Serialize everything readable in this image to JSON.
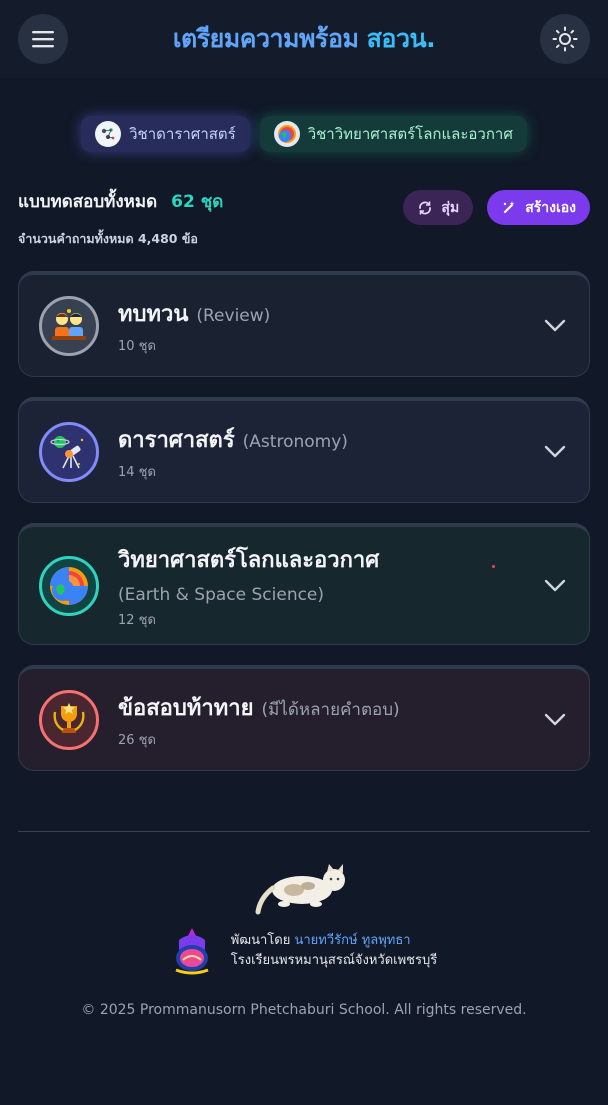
{
  "header": {
    "title_main": "เตรียมความพร้อม",
    "title_accent": "สอวน."
  },
  "subjects": [
    {
      "label": "วิชาดาราศาสตร์",
      "icon": "constellation-icon"
    },
    {
      "label": "วิชาวิทยาศาสตร์โลกและอวกาศ",
      "icon": "earth-icon"
    }
  ],
  "summary": {
    "title": "แบบทดสอบทั้งหมด",
    "count": "62 ชุด",
    "sub": "จำนวนคำถามทั้งหมด 4,480 ข้อ",
    "random_label": "สุ่ม",
    "create_label": "สร้างเอง"
  },
  "categories": [
    {
      "name": "ทบทวน",
      "en": "(Review)",
      "count": "10 ชุด",
      "icon": "students-icon"
    },
    {
      "name": "ดาราศาสตร์",
      "en": "(Astronomy)",
      "count": "14 ชุด",
      "icon": "telescope-icon"
    },
    {
      "name": "วิทยาศาสตร์โลกและอวกาศ",
      "en": "(Earth & Space Science)",
      "count": "12 ชุด",
      "icon": "earth-layers-icon"
    },
    {
      "name": "ข้อสอบท้าทาย",
      "en": "(มีได้หลายคำตอบ)",
      "count": "26 ชุด",
      "icon": "trophy-icon"
    }
  ],
  "footer": {
    "developed_by": "พัฒนาโดย",
    "author": "นายทวีรักษ์ ทูลพุทธา",
    "school": "โรงเรียนพรหมานุสรณ์จังหวัดเพชรบุรี",
    "copyright": "© 2025 Prommanusorn Phetchaburi School. All rights reserved."
  },
  "colors": {
    "background": "#111827",
    "accent_blue": "#60a5fa",
    "teal": "#2dd4bf",
    "purple": "#7c3aed"
  }
}
